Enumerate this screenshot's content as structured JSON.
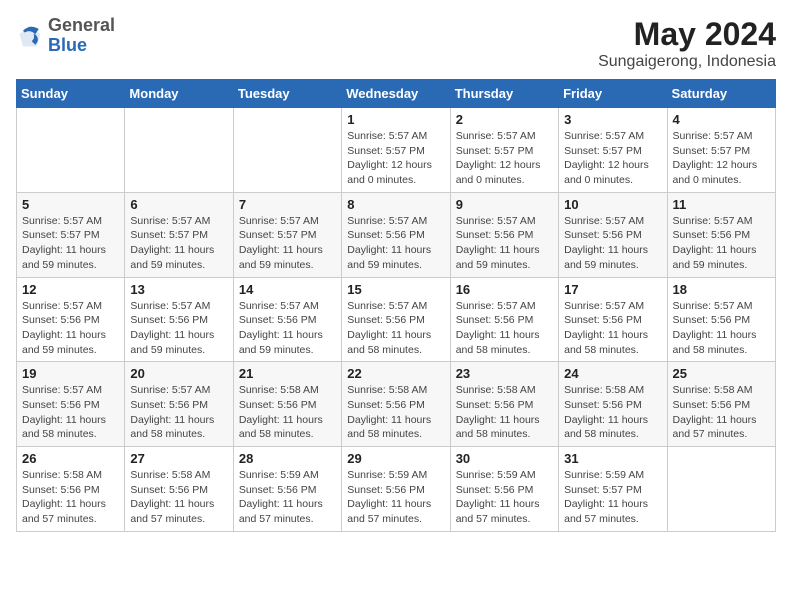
{
  "header": {
    "logo_general": "General",
    "logo_blue": "Blue",
    "title": "May 2024",
    "subtitle": "Sungaigerong, Indonesia"
  },
  "weekdays": [
    "Sunday",
    "Monday",
    "Tuesday",
    "Wednesday",
    "Thursday",
    "Friday",
    "Saturday"
  ],
  "weeks": [
    [
      {
        "day": null
      },
      {
        "day": null
      },
      {
        "day": null
      },
      {
        "day": "1",
        "sunrise": "Sunrise: 5:57 AM",
        "sunset": "Sunset: 5:57 PM",
        "daylight": "Daylight: 12 hours and 0 minutes."
      },
      {
        "day": "2",
        "sunrise": "Sunrise: 5:57 AM",
        "sunset": "Sunset: 5:57 PM",
        "daylight": "Daylight: 12 hours and 0 minutes."
      },
      {
        "day": "3",
        "sunrise": "Sunrise: 5:57 AM",
        "sunset": "Sunset: 5:57 PM",
        "daylight": "Daylight: 12 hours and 0 minutes."
      },
      {
        "day": "4",
        "sunrise": "Sunrise: 5:57 AM",
        "sunset": "Sunset: 5:57 PM",
        "daylight": "Daylight: 12 hours and 0 minutes."
      }
    ],
    [
      {
        "day": "5",
        "sunrise": "Sunrise: 5:57 AM",
        "sunset": "Sunset: 5:57 PM",
        "daylight": "Daylight: 11 hours and 59 minutes."
      },
      {
        "day": "6",
        "sunrise": "Sunrise: 5:57 AM",
        "sunset": "Sunset: 5:57 PM",
        "daylight": "Daylight: 11 hours and 59 minutes."
      },
      {
        "day": "7",
        "sunrise": "Sunrise: 5:57 AM",
        "sunset": "Sunset: 5:57 PM",
        "daylight": "Daylight: 11 hours and 59 minutes."
      },
      {
        "day": "8",
        "sunrise": "Sunrise: 5:57 AM",
        "sunset": "Sunset: 5:56 PM",
        "daylight": "Daylight: 11 hours and 59 minutes."
      },
      {
        "day": "9",
        "sunrise": "Sunrise: 5:57 AM",
        "sunset": "Sunset: 5:56 PM",
        "daylight": "Daylight: 11 hours and 59 minutes."
      },
      {
        "day": "10",
        "sunrise": "Sunrise: 5:57 AM",
        "sunset": "Sunset: 5:56 PM",
        "daylight": "Daylight: 11 hours and 59 minutes."
      },
      {
        "day": "11",
        "sunrise": "Sunrise: 5:57 AM",
        "sunset": "Sunset: 5:56 PM",
        "daylight": "Daylight: 11 hours and 59 minutes."
      }
    ],
    [
      {
        "day": "12",
        "sunrise": "Sunrise: 5:57 AM",
        "sunset": "Sunset: 5:56 PM",
        "daylight": "Daylight: 11 hours and 59 minutes."
      },
      {
        "day": "13",
        "sunrise": "Sunrise: 5:57 AM",
        "sunset": "Sunset: 5:56 PM",
        "daylight": "Daylight: 11 hours and 59 minutes."
      },
      {
        "day": "14",
        "sunrise": "Sunrise: 5:57 AM",
        "sunset": "Sunset: 5:56 PM",
        "daylight": "Daylight: 11 hours and 59 minutes."
      },
      {
        "day": "15",
        "sunrise": "Sunrise: 5:57 AM",
        "sunset": "Sunset: 5:56 PM",
        "daylight": "Daylight: 11 hours and 58 minutes."
      },
      {
        "day": "16",
        "sunrise": "Sunrise: 5:57 AM",
        "sunset": "Sunset: 5:56 PM",
        "daylight": "Daylight: 11 hours and 58 minutes."
      },
      {
        "day": "17",
        "sunrise": "Sunrise: 5:57 AM",
        "sunset": "Sunset: 5:56 PM",
        "daylight": "Daylight: 11 hours and 58 minutes."
      },
      {
        "day": "18",
        "sunrise": "Sunrise: 5:57 AM",
        "sunset": "Sunset: 5:56 PM",
        "daylight": "Daylight: 11 hours and 58 minutes."
      }
    ],
    [
      {
        "day": "19",
        "sunrise": "Sunrise: 5:57 AM",
        "sunset": "Sunset: 5:56 PM",
        "daylight": "Daylight: 11 hours and 58 minutes."
      },
      {
        "day": "20",
        "sunrise": "Sunrise: 5:57 AM",
        "sunset": "Sunset: 5:56 PM",
        "daylight": "Daylight: 11 hours and 58 minutes."
      },
      {
        "day": "21",
        "sunrise": "Sunrise: 5:58 AM",
        "sunset": "Sunset: 5:56 PM",
        "daylight": "Daylight: 11 hours and 58 minutes."
      },
      {
        "day": "22",
        "sunrise": "Sunrise: 5:58 AM",
        "sunset": "Sunset: 5:56 PM",
        "daylight": "Daylight: 11 hours and 58 minutes."
      },
      {
        "day": "23",
        "sunrise": "Sunrise: 5:58 AM",
        "sunset": "Sunset: 5:56 PM",
        "daylight": "Daylight: 11 hours and 58 minutes."
      },
      {
        "day": "24",
        "sunrise": "Sunrise: 5:58 AM",
        "sunset": "Sunset: 5:56 PM",
        "daylight": "Daylight: 11 hours and 58 minutes."
      },
      {
        "day": "25",
        "sunrise": "Sunrise: 5:58 AM",
        "sunset": "Sunset: 5:56 PM",
        "daylight": "Daylight: 11 hours and 57 minutes."
      }
    ],
    [
      {
        "day": "26",
        "sunrise": "Sunrise: 5:58 AM",
        "sunset": "Sunset: 5:56 PM",
        "daylight": "Daylight: 11 hours and 57 minutes."
      },
      {
        "day": "27",
        "sunrise": "Sunrise: 5:58 AM",
        "sunset": "Sunset: 5:56 PM",
        "daylight": "Daylight: 11 hours and 57 minutes."
      },
      {
        "day": "28",
        "sunrise": "Sunrise: 5:59 AM",
        "sunset": "Sunset: 5:56 PM",
        "daylight": "Daylight: 11 hours and 57 minutes."
      },
      {
        "day": "29",
        "sunrise": "Sunrise: 5:59 AM",
        "sunset": "Sunset: 5:56 PM",
        "daylight": "Daylight: 11 hours and 57 minutes."
      },
      {
        "day": "30",
        "sunrise": "Sunrise: 5:59 AM",
        "sunset": "Sunset: 5:56 PM",
        "daylight": "Daylight: 11 hours and 57 minutes."
      },
      {
        "day": "31",
        "sunrise": "Sunrise: 5:59 AM",
        "sunset": "Sunset: 5:57 PM",
        "daylight": "Daylight: 11 hours and 57 minutes."
      },
      {
        "day": null
      }
    ]
  ]
}
